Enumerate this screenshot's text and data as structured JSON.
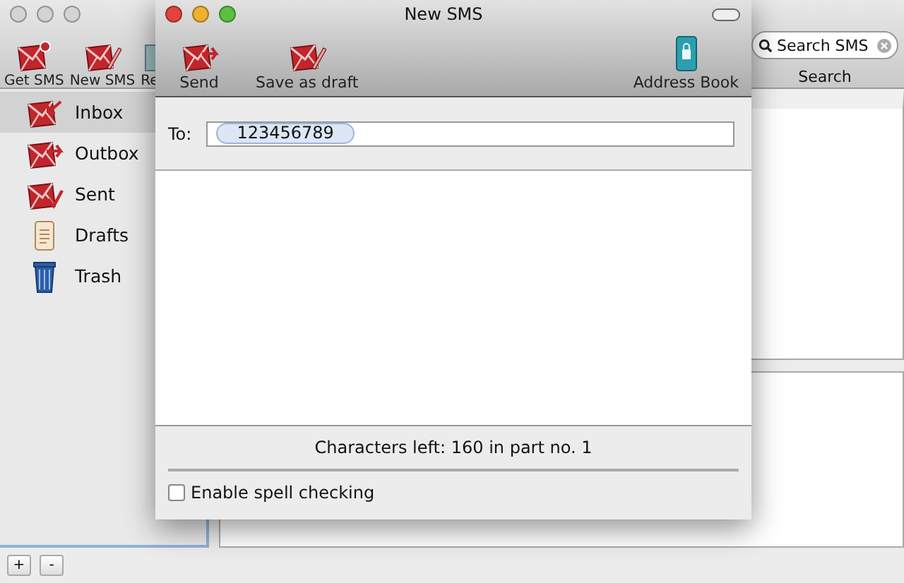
{
  "main_window": {
    "toolbar": [
      {
        "label": "Get SMS",
        "kind": "get"
      },
      {
        "label": "New SMS",
        "kind": "new"
      },
      {
        "label": "Re",
        "kind": "cut"
      }
    ],
    "search": {
      "placeholder": "Search SMS",
      "label": "Search"
    },
    "sidebar": {
      "items": [
        {
          "label": "Inbox",
          "kind": "inbox",
          "selected": true
        },
        {
          "label": "Outbox",
          "kind": "outbox",
          "selected": false
        },
        {
          "label": "Sent",
          "kind": "sent",
          "selected": false
        },
        {
          "label": "Drafts",
          "kind": "drafts",
          "selected": false
        },
        {
          "label": "Trash",
          "kind": "trash",
          "selected": false
        }
      ]
    },
    "bottom_buttons": [
      "+",
      "-"
    ]
  },
  "dialog": {
    "title": "New SMS",
    "toolbar": [
      {
        "label": "Send",
        "kind": "send"
      },
      {
        "label": "Save as draft",
        "kind": "draft"
      },
      {
        "label": "Address Book",
        "kind": "book"
      }
    ],
    "to_label": "To:",
    "recipients": [
      "123456789"
    ],
    "status": "Characters left: 160 in part no. 1",
    "spell_check": {
      "label": "Enable spell checking",
      "checked": false
    }
  }
}
